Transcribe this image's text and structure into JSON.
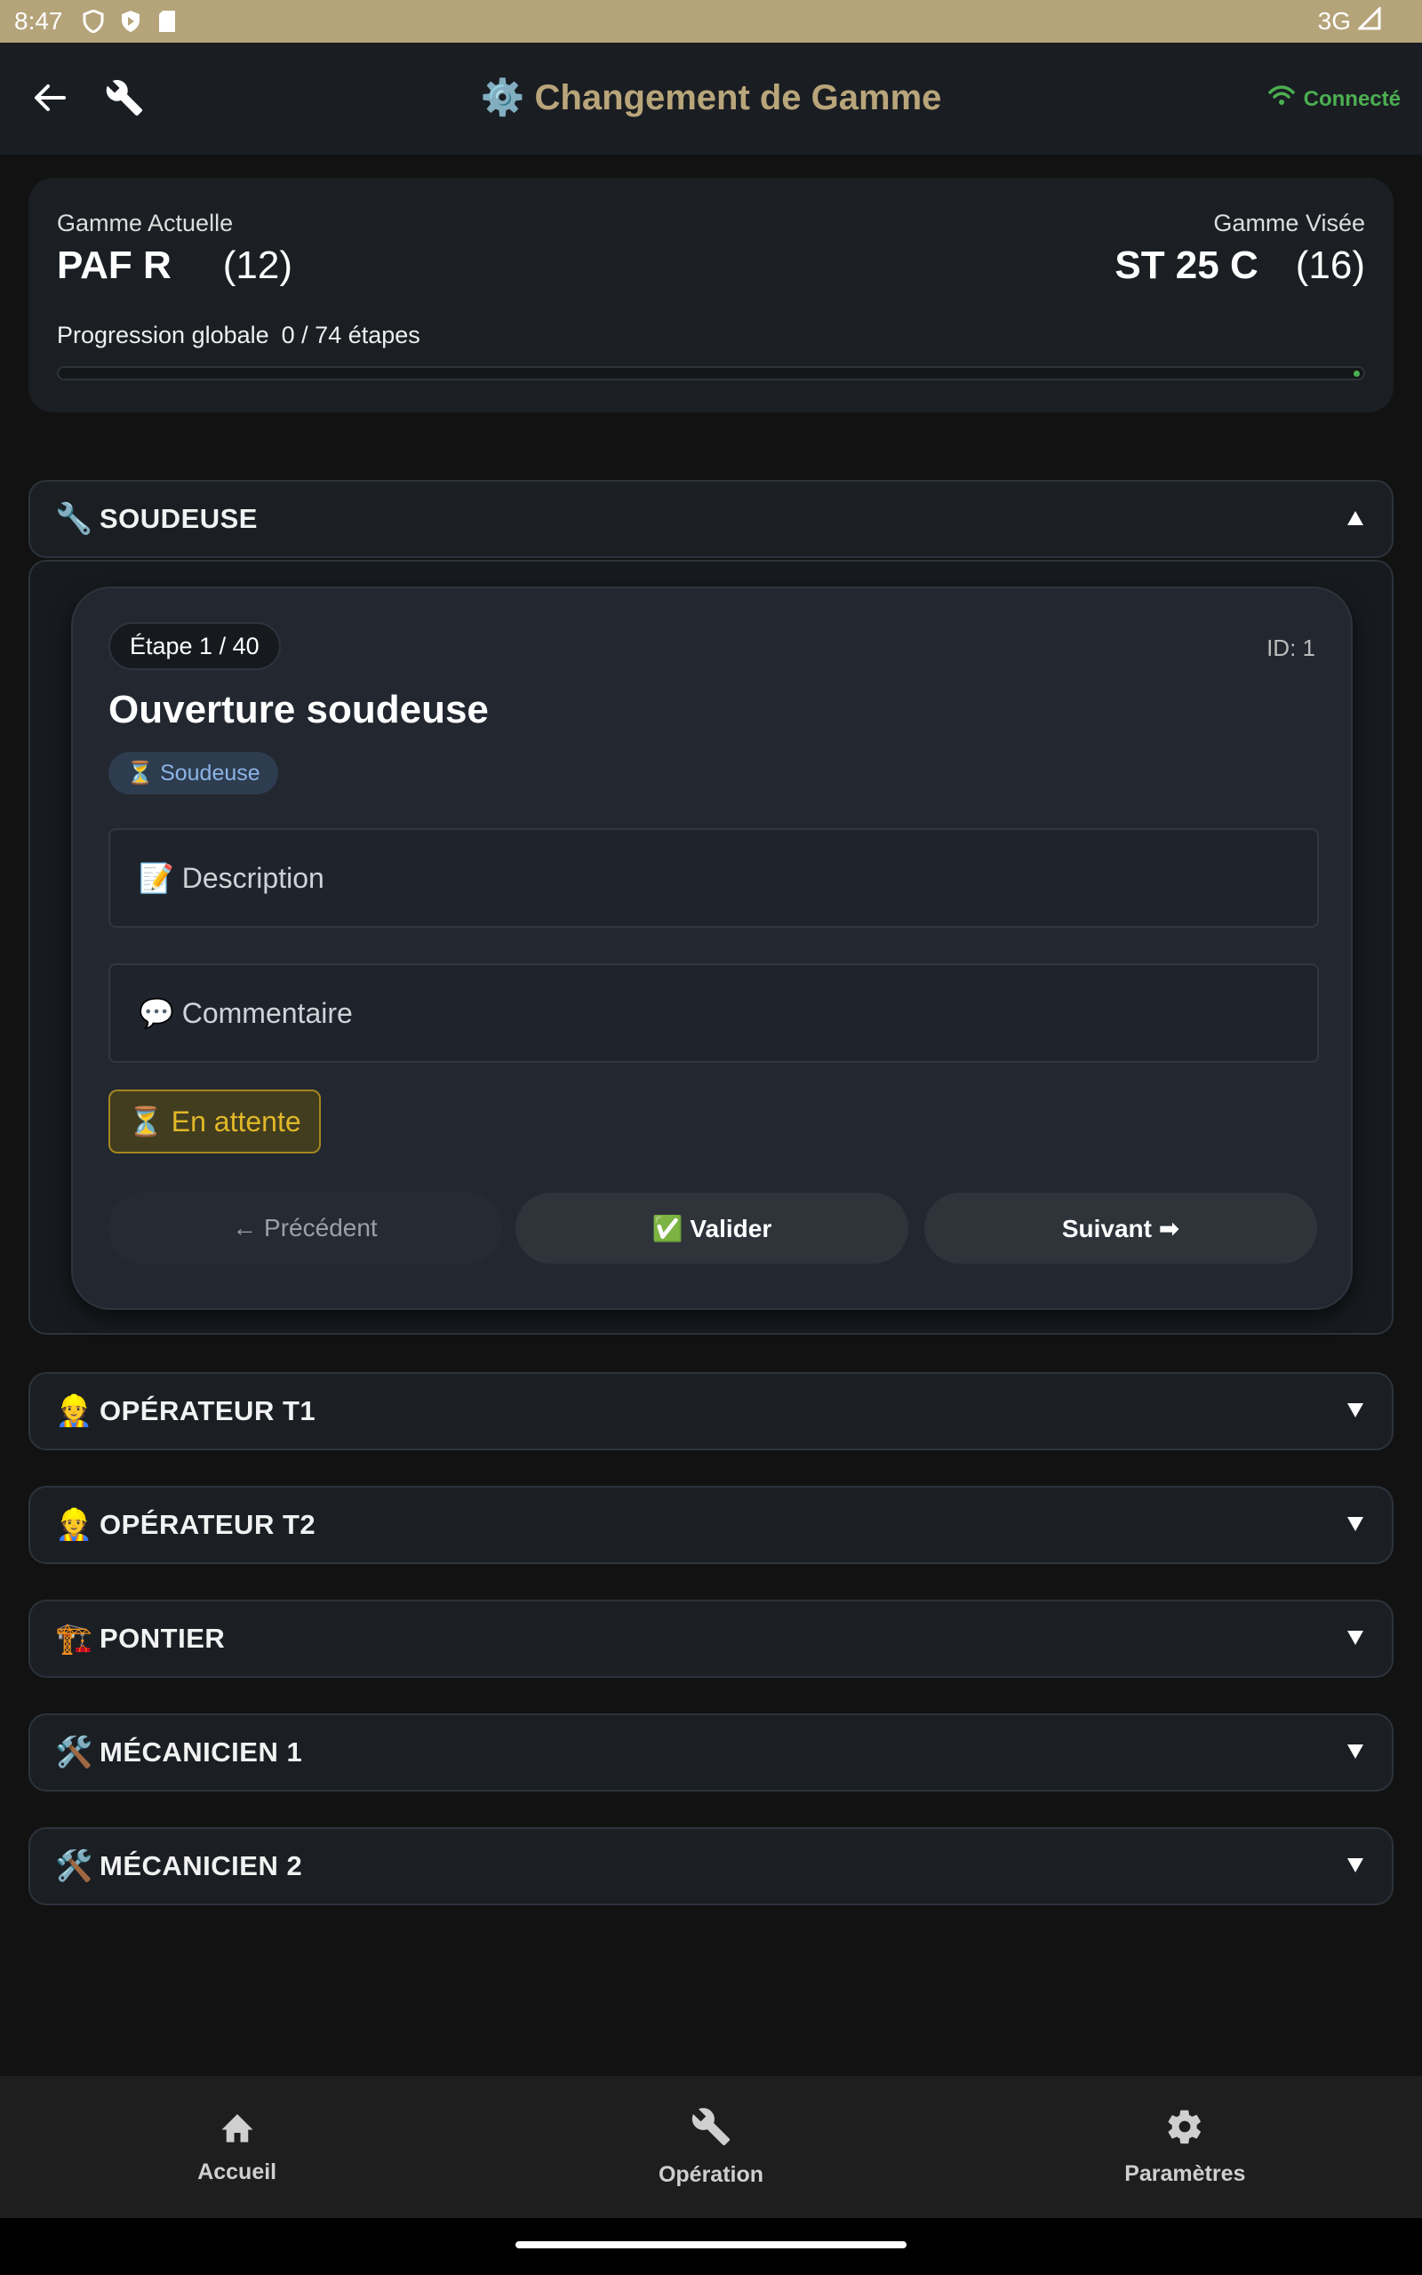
{
  "status_bar": {
    "time": "8:47",
    "network": "3G"
  },
  "app_bar": {
    "title": "⚙️ Changement de Gamme",
    "connection": "Connecté"
  },
  "summary": {
    "current_label": "Gamme Actuelle",
    "current_value": "PAF R",
    "current_num": "(12)",
    "target_label": "Gamme Visée",
    "target_value": "ST 25 C",
    "target_num": "(16)",
    "progress_label": "Progression globale",
    "progress_count": "0 / 74 étapes",
    "progress_value": 0
  },
  "sections": [
    {
      "emoji": "🔧",
      "label": "SOUDEUSE",
      "expanded": true
    },
    {
      "emoji": "👷",
      "label": "OPÉRATEUR T1",
      "expanded": false
    },
    {
      "emoji": "👷",
      "label": "OPÉRATEUR T2",
      "expanded": false
    },
    {
      "emoji": "🏗️",
      "label": "PONTIER",
      "expanded": false
    },
    {
      "emoji": "🛠️",
      "label": "MÉCANICIEN 1",
      "expanded": false
    },
    {
      "emoji": "🛠️",
      "label": "MÉCANICIEN 2",
      "expanded": false
    }
  ],
  "step": {
    "counter": "Étape 1 / 40",
    "id": "ID: 1",
    "title": "Ouverture soudeuse",
    "role": "⏳ Soudeuse",
    "description_label": "📝 Description",
    "comment_label": "💬 Commentaire",
    "status": "⏳ En attente",
    "prev_label": "← Précédent",
    "validate_label": "✅ Valider",
    "next_label": "Suivant ➡"
  },
  "bottom_nav": [
    {
      "label": "Accueil",
      "icon": "home-icon"
    },
    {
      "label": "Opération",
      "icon": "wrench-icon"
    },
    {
      "label": "Paramètres",
      "icon": "gear-icon"
    }
  ],
  "colors": {
    "accent": "#b9a57a",
    "connected": "#4caf50",
    "pending": "#e0b728",
    "role": "#8bb4e6"
  }
}
